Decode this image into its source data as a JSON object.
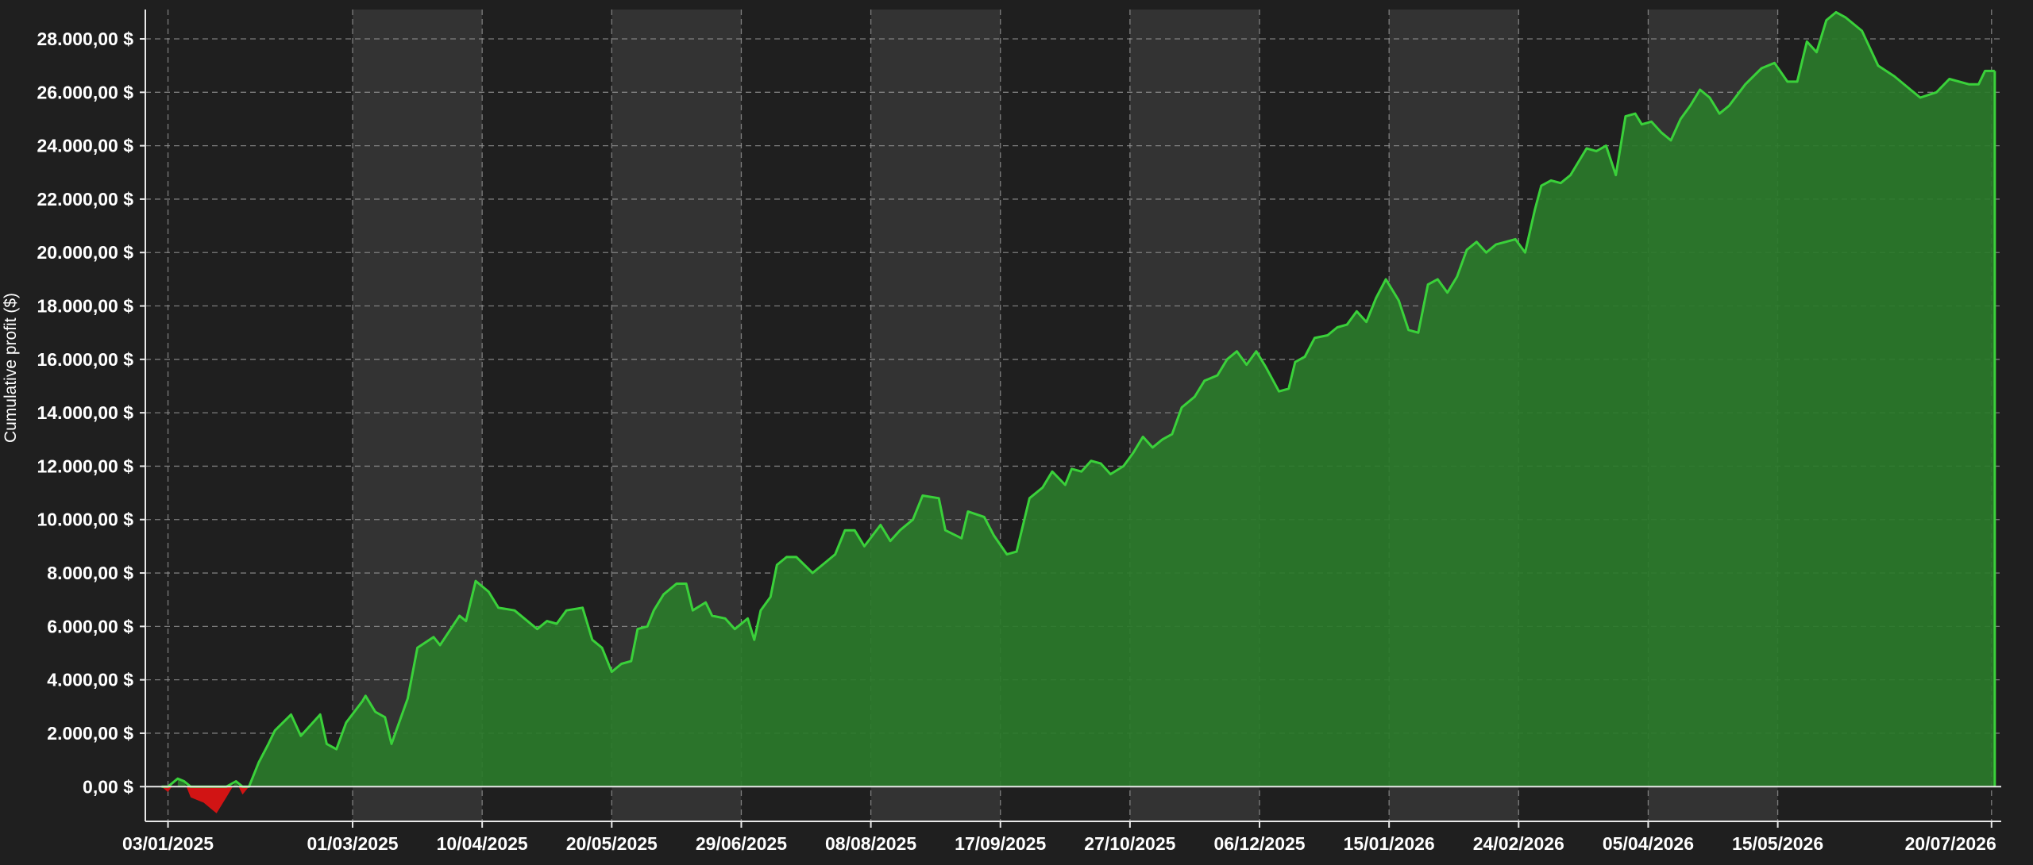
{
  "chart_data": {
    "type": "area",
    "title": "",
    "ylabel": "Cumulative profit ($)",
    "xlabel": "",
    "ylim": [
      -1300,
      29100
    ],
    "xlim": [
      "2024-12-27",
      "2026-07-23"
    ],
    "y_ticks": [
      "0,00 $",
      "2.000,00 $",
      "4.000,00 $",
      "6.000,00 $",
      "8.000,00 $",
      "10.000,00 $",
      "12.000,00 $",
      "14.000,00 $",
      "16.000,00 $",
      "18.000,00 $",
      "20.000,00 $",
      "22.000,00 $",
      "24.000,00 $",
      "26.000,00 $",
      "28.000,00 $"
    ],
    "y_tick_values": [
      0,
      2000,
      4000,
      6000,
      8000,
      10000,
      12000,
      14000,
      16000,
      18000,
      20000,
      22000,
      24000,
      26000,
      28000
    ],
    "x_ticks": [
      "03/01/2025",
      "01/03/2025",
      "10/04/2025",
      "20/05/2025",
      "29/06/2025",
      "08/08/2025",
      "17/09/2025",
      "27/10/2025",
      "06/12/2025",
      "15/01/2026",
      "24/02/2026",
      "05/04/2026",
      "15/05/2026",
      "20/07/2026"
    ],
    "x_tick_dates": [
      "2025-01-03",
      "2025-03-01",
      "2025-04-10",
      "2025-05-20",
      "2025-06-29",
      "2025-08-08",
      "2025-09-17",
      "2025-10-27",
      "2025-12-06",
      "2026-01-15",
      "2026-02-24",
      "2026-04-05",
      "2026-05-15",
      "2026-07-20"
    ],
    "grid": true,
    "colors": {
      "positive_line": "#3ad13a",
      "positive_fill": "#2a7a2a",
      "negative_fill": "#d11414",
      "background": "#1f1f1f",
      "band": "#333333",
      "grid": "#9a9a9a",
      "text": "#ffffff"
    },
    "series": [
      {
        "name": "",
        "points": [
          [
            "2025-01-01",
            0
          ],
          [
            "2025-01-03",
            -200
          ],
          [
            "2025-01-06",
            300
          ],
          [
            "2025-01-08",
            200
          ],
          [
            "2025-01-10",
            -400
          ],
          [
            "2025-01-14",
            -600
          ],
          [
            "2025-01-16",
            -800
          ],
          [
            "2025-01-18",
            -1000
          ],
          [
            "2025-01-21",
            -400
          ],
          [
            "2025-01-24",
            200
          ],
          [
            "2025-01-26",
            -300
          ],
          [
            "2025-01-28",
            0
          ],
          [
            "2025-01-31",
            900
          ],
          [
            "2025-02-03",
            1600
          ],
          [
            "2025-02-05",
            2100
          ],
          [
            "2025-02-10",
            2700
          ],
          [
            "2025-02-13",
            1900
          ],
          [
            "2025-02-19",
            2700
          ],
          [
            "2025-02-21",
            1600
          ],
          [
            "2025-02-24",
            1400
          ],
          [
            "2025-02-27",
            2400
          ],
          [
            "2025-03-04",
            3200
          ],
          [
            "2025-03-05",
            3400
          ],
          [
            "2025-03-08",
            2800
          ],
          [
            "2025-03-11",
            2600
          ],
          [
            "2025-03-13",
            1600
          ],
          [
            "2025-03-18",
            3300
          ],
          [
            "2025-03-21",
            5200
          ],
          [
            "2025-03-26",
            5600
          ],
          [
            "2025-03-28",
            5300
          ],
          [
            "2025-04-03",
            6400
          ],
          [
            "2025-04-05",
            6200
          ],
          [
            "2025-04-08",
            7700
          ],
          [
            "2025-04-12",
            7300
          ],
          [
            "2025-04-15",
            6700
          ],
          [
            "2025-04-20",
            6600
          ],
          [
            "2025-04-23",
            6300
          ],
          [
            "2025-04-27",
            5900
          ],
          [
            "2025-04-30",
            6200
          ],
          [
            "2025-05-03",
            6100
          ],
          [
            "2025-05-06",
            6600
          ],
          [
            "2025-05-11",
            6700
          ],
          [
            "2025-05-14",
            5500
          ],
          [
            "2025-05-17",
            5200
          ],
          [
            "2025-05-20",
            4300
          ],
          [
            "2025-05-23",
            4600
          ],
          [
            "2025-05-26",
            4700
          ],
          [
            "2025-05-28",
            5900
          ],
          [
            "2025-05-31",
            6000
          ],
          [
            "2025-06-02",
            6600
          ],
          [
            "2025-06-05",
            7200
          ],
          [
            "2025-06-09",
            7600
          ],
          [
            "2025-06-12",
            7600
          ],
          [
            "2025-06-14",
            6600
          ],
          [
            "2025-06-18",
            6900
          ],
          [
            "2025-06-20",
            6400
          ],
          [
            "2025-06-24",
            6300
          ],
          [
            "2025-06-27",
            5900
          ],
          [
            "2025-07-01",
            6300
          ],
          [
            "2025-07-03",
            5500
          ],
          [
            "2025-07-05",
            6600
          ],
          [
            "2025-07-08",
            7100
          ],
          [
            "2025-07-10",
            8300
          ],
          [
            "2025-07-13",
            8600
          ],
          [
            "2025-07-16",
            8600
          ],
          [
            "2025-07-21",
            8000
          ],
          [
            "2025-07-25",
            8400
          ],
          [
            "2025-07-28",
            8700
          ],
          [
            "2025-07-31",
            9600
          ],
          [
            "2025-08-03",
            9600
          ],
          [
            "2025-08-06",
            9000
          ],
          [
            "2025-08-11",
            9800
          ],
          [
            "2025-08-14",
            9200
          ],
          [
            "2025-08-17",
            9600
          ],
          [
            "2025-08-21",
            10000
          ],
          [
            "2025-08-24",
            10900
          ],
          [
            "2025-08-29",
            10800
          ],
          [
            "2025-08-31",
            9600
          ],
          [
            "2025-09-05",
            9300
          ],
          [
            "2025-09-07",
            10300
          ],
          [
            "2025-09-12",
            10100
          ],
          [
            "2025-09-15",
            9400
          ],
          [
            "2025-09-19",
            8700
          ],
          [
            "2025-09-22",
            8800
          ],
          [
            "2025-09-26",
            10800
          ],
          [
            "2025-09-30",
            11200
          ],
          [
            "2025-10-03",
            11800
          ],
          [
            "2025-10-07",
            11300
          ],
          [
            "2025-10-09",
            11900
          ],
          [
            "2025-10-12",
            11800
          ],
          [
            "2025-10-15",
            12200
          ],
          [
            "2025-10-18",
            12100
          ],
          [
            "2025-10-21",
            11700
          ],
          [
            "2025-10-25",
            12000
          ],
          [
            "2025-10-28",
            12500
          ],
          [
            "2025-10-31",
            13100
          ],
          [
            "2025-11-03",
            12700
          ],
          [
            "2025-11-06",
            13000
          ],
          [
            "2025-11-09",
            13200
          ],
          [
            "2025-11-12",
            14200
          ],
          [
            "2025-11-16",
            14600
          ],
          [
            "2025-11-19",
            15200
          ],
          [
            "2025-11-23",
            15400
          ],
          [
            "2025-11-26",
            16000
          ],
          [
            "2025-11-29",
            16300
          ],
          [
            "2025-12-02",
            15800
          ],
          [
            "2025-12-05",
            16300
          ],
          [
            "2025-12-08",
            15700
          ],
          [
            "2025-12-12",
            14800
          ],
          [
            "2025-12-15",
            14900
          ],
          [
            "2025-12-17",
            15900
          ],
          [
            "2025-12-20",
            16100
          ],
          [
            "2025-12-23",
            16800
          ],
          [
            "2025-12-27",
            16900
          ],
          [
            "2025-12-30",
            17200
          ],
          [
            "2026-01-02",
            17300
          ],
          [
            "2026-01-05",
            17800
          ],
          [
            "2026-01-08",
            17400
          ],
          [
            "2026-01-11",
            18300
          ],
          [
            "2026-01-14",
            19000
          ],
          [
            "2026-01-18",
            18200
          ],
          [
            "2026-01-21",
            17100
          ],
          [
            "2026-01-24",
            17000
          ],
          [
            "2026-01-27",
            18800
          ],
          [
            "2026-01-30",
            19000
          ],
          [
            "2026-02-02",
            18500
          ],
          [
            "2026-02-05",
            19100
          ],
          [
            "2026-02-08",
            20100
          ],
          [
            "2026-02-11",
            20400
          ],
          [
            "2026-02-14",
            20000
          ],
          [
            "2026-02-17",
            20300
          ],
          [
            "2026-02-20",
            20400
          ],
          [
            "2026-02-23",
            20500
          ],
          [
            "2026-02-26",
            20000
          ],
          [
            "2026-03-01",
            21600
          ],
          [
            "2026-03-03",
            22500
          ],
          [
            "2026-03-06",
            22700
          ],
          [
            "2026-03-09",
            22600
          ],
          [
            "2026-03-12",
            22900
          ],
          [
            "2026-03-15",
            23500
          ],
          [
            "2026-03-17",
            23900
          ],
          [
            "2026-03-20",
            23800
          ],
          [
            "2026-03-23",
            24000
          ],
          [
            "2026-03-26",
            22900
          ],
          [
            "2026-03-29",
            25100
          ],
          [
            "2026-04-01",
            25200
          ],
          [
            "2026-04-03",
            24800
          ],
          [
            "2026-04-06",
            24900
          ],
          [
            "2026-04-09",
            24500
          ],
          [
            "2026-04-12",
            24200
          ],
          [
            "2026-04-15",
            25000
          ],
          [
            "2026-04-18",
            25500
          ],
          [
            "2026-04-21",
            26100
          ],
          [
            "2026-04-24",
            25800
          ],
          [
            "2026-04-27",
            25200
          ],
          [
            "2026-04-30",
            25500
          ],
          [
            "2026-05-05",
            26300
          ],
          [
            "2026-05-10",
            26900
          ],
          [
            "2026-05-14",
            27100
          ],
          [
            "2026-05-18",
            26400
          ],
          [
            "2026-05-21",
            26400
          ],
          [
            "2026-05-24",
            27900
          ],
          [
            "2026-05-27",
            27500
          ],
          [
            "2026-05-30",
            28700
          ],
          [
            "2026-06-02",
            29000
          ],
          [
            "2026-06-05",
            28800
          ],
          [
            "2026-06-10",
            28300
          ],
          [
            "2026-06-15",
            27000
          ],
          [
            "2026-06-20",
            26600
          ],
          [
            "2026-06-25",
            26100
          ],
          [
            "2026-06-28",
            25800
          ],
          [
            "2026-07-03",
            26000
          ],
          [
            "2026-07-07",
            26500
          ],
          [
            "2026-07-13",
            26300
          ],
          [
            "2026-07-16",
            26300
          ],
          [
            "2026-07-18",
            26800
          ],
          [
            "2026-07-21",
            26800
          ]
        ]
      }
    ]
  }
}
